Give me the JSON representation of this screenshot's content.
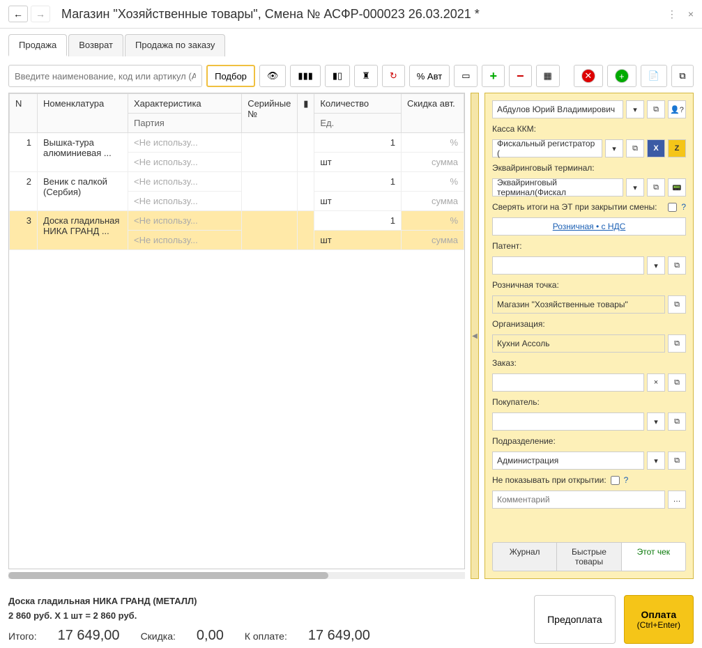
{
  "header": {
    "title": "Магазин \"Хозяйственные товары\", Смена № АСФР-000023  26.03.2021 *"
  },
  "tabs": [
    {
      "label": "Продажа",
      "active": true
    },
    {
      "label": "Возврат",
      "active": false
    },
    {
      "label": "Продажа по заказу",
      "active": false
    }
  ],
  "search": {
    "placeholder": "Введите наименование, код или артикул (Alt+F)"
  },
  "toolbar": {
    "podbor": "Подбор",
    "pct_avt": "% Авт"
  },
  "grid": {
    "headers": {
      "n": "N",
      "nom": "Номенклатура",
      "char": "Характеристика",
      "party": "Партия",
      "serial": "Серийные №",
      "qty": "Количество",
      "unit": "Ед.",
      "discount": "Скидка авт."
    },
    "rows": [
      {
        "n": "1",
        "nom": "Вышка-тура алюминиевая ...",
        "char": "<Не использу...",
        "party": "<Не использу...",
        "qty": "1",
        "unit": "шт",
        "pct": "%",
        "sum": "сумма"
      },
      {
        "n": "2",
        "nom": "Веник с палкой (Сербия)",
        "char": "<Не использу...",
        "party": "<Не использу...",
        "qty": "1",
        "unit": "шт",
        "pct": "%",
        "sum": "сумма"
      },
      {
        "n": "3",
        "nom": "Доска гладильная  НИКА ГРАНД ...",
        "char": "<Не использу...",
        "party": "<Не использу...",
        "qty": "1",
        "unit": "шт",
        "pct": "%",
        "sum": "сумма",
        "selected": true
      }
    ]
  },
  "side": {
    "cashier": "Абдулов Юрий Владимирович",
    "kkm_label": "Касса ККМ:",
    "kkm_value": "Фискальный регистратор (",
    "acq_label": "Эквайринговый терминал:",
    "acq_value": "Эквайринговый терминал(Фискал",
    "verify_label": "Сверять итоги на ЭТ при закрытии смены:",
    "retail_link": "Розничная • с НДС",
    "patent_label": "Патент:",
    "point_label": "Розничная точка:",
    "point_value": "Магазин \"Хозяйственные товары\"",
    "org_label": "Организация:",
    "org_value": "Кухни Ассоль",
    "order_label": "Заказ:",
    "buyer_label": "Покупатель:",
    "dept_label": "Подразделение:",
    "dept_value": "Администрация",
    "hide_label": "Не показывать при открытии:",
    "comment_placeholder": "Комментарий",
    "tabs": {
      "journal": "Журнал",
      "fast": "Быстрые товары",
      "this": "Этот чек"
    }
  },
  "footer": {
    "item_name": "Доска гладильная  НИКА ГРАНД (МЕТАЛЛ)",
    "item_price": "2 860 руб. X 1 шт = 2 860 руб.",
    "total_label": "Итого:",
    "total_value": "17 649,00",
    "discount_label": "Скидка:",
    "discount_value": "0,00",
    "topay_label": "К оплате:",
    "topay_value": "17 649,00",
    "prepay": "Предоплата",
    "pay": "Оплата",
    "pay_hint": "(Ctrl+Enter)"
  }
}
